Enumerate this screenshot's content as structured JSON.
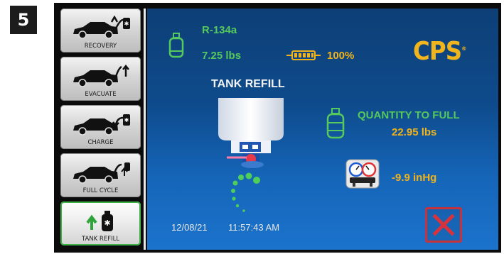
{
  "step_number": "5",
  "sidebar": {
    "items": [
      {
        "label": "RECOVERY",
        "icon": "car-recovery-icon"
      },
      {
        "label": "EVACUATE",
        "icon": "car-evacuate-icon"
      },
      {
        "label": "CHARGE",
        "icon": "car-charge-icon"
      },
      {
        "label": "FULL CYCLE",
        "icon": "car-full-cycle-icon"
      },
      {
        "label": "TANK REFILL",
        "icon": "tank-refill-icon",
        "active": true
      }
    ]
  },
  "status": {
    "refrigerant": "R-134a",
    "tank_weight": "7.25 lbs",
    "battery_percent": "100%"
  },
  "brand": "CPS",
  "main": {
    "title": "TANK REFILL",
    "quantity_label": "QUANTITY TO FULL",
    "quantity_value": "22.95 lbs",
    "pressure_value": "-9.9 inHg",
    "date": "12/08/21",
    "time": "11:57:43 AM"
  },
  "colors": {
    "accent_green": "#56c95c",
    "accent_amber": "#f2b318",
    "cancel_red": "#c8323a"
  }
}
